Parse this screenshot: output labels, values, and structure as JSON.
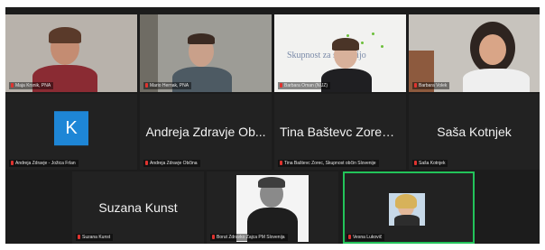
{
  "tiles": [
    {
      "name": "Maja Krsnik, PNA"
    },
    {
      "name": "Mario Hernak, PNA"
    },
    {
      "name": "Barbara Oman (NIJZ)",
      "slide_text": "Skupnost za slovenijo"
    },
    {
      "name": "Barbara Volek"
    },
    {
      "name": "Andreja Zdravje - Jožica Frlan",
      "logo_letter": "K"
    },
    {
      "name": "Andreja Zdravje Občina",
      "display": "Andreja Zdravje Ob..."
    },
    {
      "name": "Tina Baštevc Zorec, Skupnost občin Slovenije",
      "display": "Tina Baštevc Zorec,..."
    },
    {
      "name": "Saša Kotnjek",
      "display": "Saša Kotnjek"
    },
    {
      "name": "Suzana Kunst",
      "display": "Suzana Kunst"
    },
    {
      "name": "Borut Zdravko Zajca PM Slovenija"
    },
    {
      "name": "Vesna Lukovič"
    }
  ],
  "colors": {
    "active_speaker": "#23c35a",
    "muted_mic": "#e0332f",
    "k_logo": "#1e86d6"
  }
}
